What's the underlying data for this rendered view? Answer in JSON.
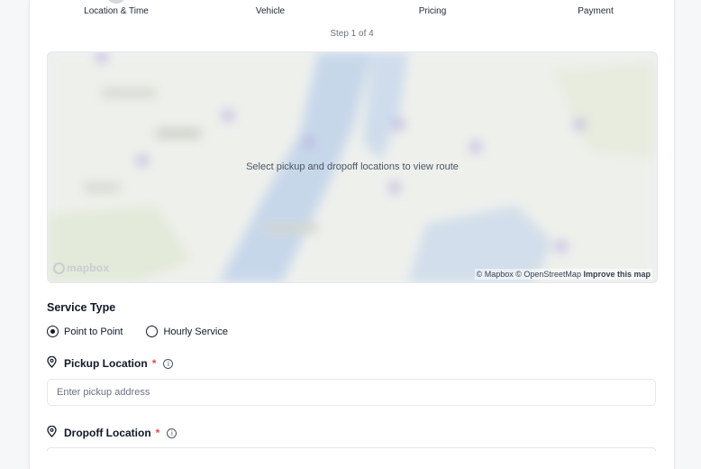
{
  "steps": [
    {
      "label": "Location & Time"
    },
    {
      "label": "Vehicle"
    },
    {
      "label": "Pricing"
    },
    {
      "label": "Payment"
    }
  ],
  "step_counter": "Step 1 of 4",
  "map": {
    "message": "Select pickup and dropoff locations to view route",
    "logo_text": "mapbox",
    "attribution": "© Mapbox © OpenStreetMap",
    "improve_link": "Improve this map"
  },
  "service_type": {
    "title": "Service Type",
    "options": [
      {
        "label": "Point to Point",
        "selected": true
      },
      {
        "label": "Hourly Service",
        "selected": false
      }
    ]
  },
  "pickup": {
    "label": "Pickup Location",
    "required_mark": "*",
    "placeholder": "Enter pickup address"
  },
  "dropoff": {
    "label": "Dropoff Location",
    "required_mark": "*"
  },
  "icons": {
    "location": "map-pin-icon",
    "info": "info-circle-icon"
  },
  "colors": {
    "required": "#ef4444",
    "text": "#111827",
    "muted": "#6b7280"
  }
}
